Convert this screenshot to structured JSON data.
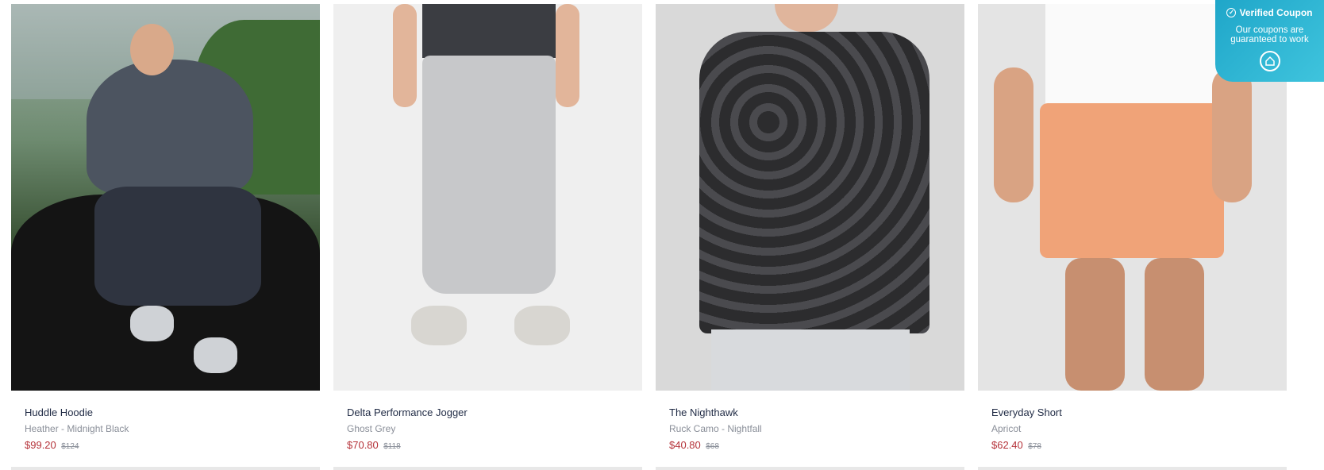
{
  "products": [
    {
      "title": "Huddle Hoodie",
      "variant": "Heather - Midnight Black",
      "price": "$99.20",
      "compare": "$124"
    },
    {
      "title": "Delta Performance Jogger",
      "variant": "Ghost Grey",
      "price": "$70.80",
      "compare": "$118"
    },
    {
      "title": "The Nighthawk",
      "variant": "Ruck Camo - Nightfall",
      "price": "$40.80",
      "compare": "$68"
    },
    {
      "title": "Everyday Short",
      "variant": "Apricot",
      "price": "$62.40",
      "compare": "$78"
    }
  ],
  "coupon": {
    "title": "Verified Coupon",
    "text": "Our coupons are guaranteed to work"
  },
  "colors": {
    "price": "#b5333a",
    "coupon_bg": "#1fa6c9"
  }
}
